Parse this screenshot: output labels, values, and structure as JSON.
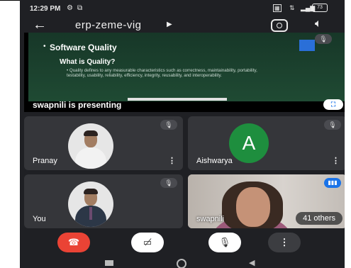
{
  "status": {
    "time": "12:29 PM",
    "battery": "73"
  },
  "header": {
    "meeting_code": "erp-zeme-vig"
  },
  "presentation": {
    "slide_title": "Software Quality",
    "slide_bullet": "•",
    "slide_subtitle": "What is Quality?",
    "slide_body": "• Quality defines to any measurable characteristics such as correctness, maintainability, portability, testability, usability, reliability, efficiency, integrity, reusability, and interoperability.",
    "presenting_label": "swapnili is presenting"
  },
  "tiles": [
    {
      "name": "Pranay"
    },
    {
      "name": "Aishwarya",
      "initial": "A"
    },
    {
      "name": "You"
    },
    {
      "name": "swapnili"
    }
  ],
  "others_label": "41 others",
  "controls": {
    "more_glyph": "⋮"
  },
  "icons": {
    "back": "arrow-left",
    "speaker": "speaker",
    "mic_off": "mic-off",
    "end_call": "phone-hangup",
    "camera_off": "camera-off"
  },
  "colors": {
    "end_call": "#ea4335",
    "avatar_green": "#1e8e3e",
    "accent": "#1a73e8"
  }
}
